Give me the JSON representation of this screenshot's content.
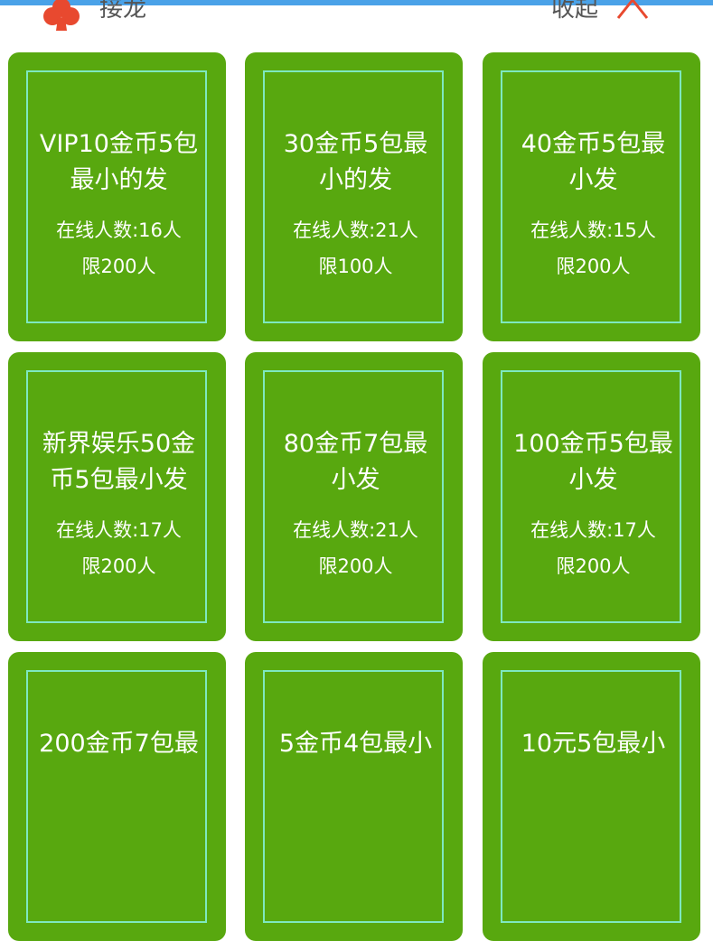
{
  "header": {
    "title": "接龙",
    "collapse_label": "收起",
    "club_color": "#e8492f",
    "chevron_color": "#e8492f"
  },
  "rooms": [
    {
      "name": "VIP10金币5包最小的发",
      "name_line1": "VIP10金币5包",
      "name_line2": "最小的发",
      "online": "在线人数:16人",
      "limit": "限200人"
    },
    {
      "name": "30金币5包最小的发",
      "name_line1": "30金币5包最",
      "name_line2": "小的发",
      "online": "在线人数:21人",
      "limit": "限100人"
    },
    {
      "name": "40金币5包最小发",
      "name_line1": "40金币5包最",
      "name_line2": "小发",
      "online": "在线人数:15人",
      "limit": "限200人"
    },
    {
      "name": "新界娱乐50金币5包最小发",
      "name_line1": "新界娱乐50金",
      "name_line2": "币5包最小发",
      "online": "在线人数:17人",
      "limit": "限200人"
    },
    {
      "name": "80金币7包最小发",
      "name_line1": "80金币7包最",
      "name_line2": "小发",
      "online": "在线人数:21人",
      "limit": "限200人"
    },
    {
      "name": "100金币5包最小发",
      "name_line1": "100金币5包最",
      "name_line2": "小发",
      "online": "在线人数:17人",
      "limit": "限200人"
    },
    {
      "name": "200金币7包最",
      "name_line1": "200金币7包最",
      "name_line2": "",
      "online": "",
      "limit": ""
    },
    {
      "name": "5金币4包最小",
      "name_line1": "5金币4包最小",
      "name_line2": "",
      "online": "",
      "limit": ""
    },
    {
      "name": "10元5包最小",
      "name_line1": "10元5包最小",
      "name_line2": "",
      "online": "",
      "limit": ""
    }
  ],
  "colors": {
    "card_bg": "#58a80f",
    "card_border": "#7ee8c0",
    "top_bar": "#4aa2e8"
  }
}
